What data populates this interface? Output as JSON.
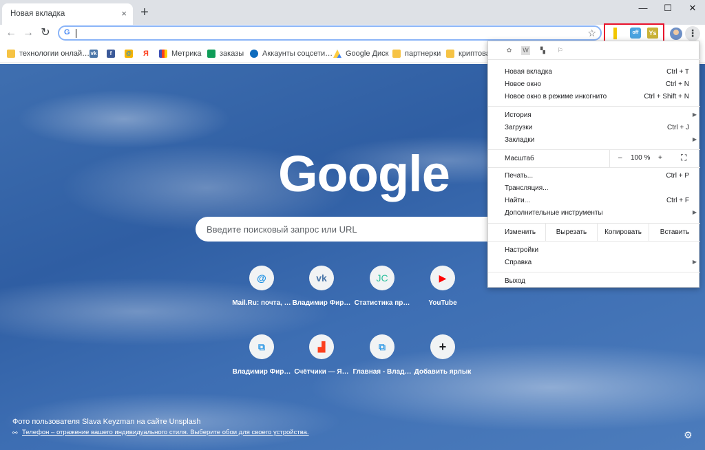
{
  "tab": {
    "title": "Новая вкладка",
    "close": "×",
    "new_tab": "+"
  },
  "window_controls": {
    "minimize": "—",
    "maximize": "☐",
    "close": "✕"
  },
  "toolbar": {
    "back": "←",
    "forward": "→",
    "reload": "↻",
    "omnibox_prefix": "G",
    "star": "☆",
    "menu": "⋮"
  },
  "extensions": [
    {
      "name": "bookmark-ext-icon",
      "glyph": "▌",
      "color": "#f2c600"
    },
    {
      "name": "proxy-off-ext-icon",
      "glyph": "off",
      "color": "#4aa3df"
    },
    {
      "name": "ys-ext-icon",
      "glyph": "Ys",
      "color": "#c9b236"
    }
  ],
  "bookmarks": [
    {
      "label": "технологии онлай…",
      "icon": "folder"
    },
    {
      "label": "",
      "icon": "vk",
      "glyph": "vk",
      "color": "#4a76a8"
    },
    {
      "label": "",
      "icon": "facebook",
      "glyph": "f",
      "color": "#3b5998"
    },
    {
      "label": "",
      "icon": "mailru",
      "glyph": "@",
      "color": "#168de2"
    },
    {
      "label": "",
      "icon": "yandex",
      "glyph": "Я",
      "color": "#ffffff"
    },
    {
      "label": "Метрика",
      "icon": "metrika"
    },
    {
      "label": "заказы",
      "icon": "sheets",
      "color": "#0f9d58"
    },
    {
      "label": "Аккаунты соцсети…",
      "icon": "onedrive",
      "color": "#0f6cbd"
    },
    {
      "label": "Google Диск",
      "icon": "drive"
    },
    {
      "label": "партнерки",
      "icon": "folder"
    },
    {
      "label": "криптова…",
      "icon": "folder"
    }
  ],
  "ntp": {
    "logo": "Google",
    "search_placeholder": "Введите поисковый запрос или URL",
    "tiles": [
      {
        "label": "Mail.Ru: почта, …",
        "glyph": "@",
        "color": "#168de2"
      },
      {
        "label": "Владимир Фир…",
        "glyph": "vk",
        "color": "#4a76a8"
      },
      {
        "label": "Статистика пр…",
        "glyph": "JC",
        "color": "#2bbf9c"
      },
      {
        "label": "YouTube",
        "glyph": "▶",
        "color": "#ff0000"
      },
      {
        "label": "Владимир Фир…",
        "glyph": "⧉",
        "color": "#3b9fe6"
      },
      {
        "label": "Счётчики — Я…",
        "glyph": "▟",
        "color": "#fc3f1d"
      },
      {
        "label": "Главная - Влад…",
        "glyph": "⧉",
        "color": "#3b9fe6"
      },
      {
        "label": "Добавить ярлык",
        "glyph": "+",
        "color": "#202124"
      }
    ],
    "credit": "Фото пользователя Slava Keyzman на сайте Unsplash",
    "credit_link": "Телефон – отражение вашего индивидуального стиля. Выберите обои для своего устройства.",
    "link_icon": "⚯",
    "gear": "⚙"
  },
  "menu": {
    "extensions_row": [
      {
        "name": "puzzle-ext-icon",
        "glyph": "✿"
      },
      {
        "name": "w-ext-icon",
        "glyph": "W"
      },
      {
        "name": "flag-ext-icon",
        "glyph": "▚"
      },
      {
        "name": "pennant-ext-icon",
        "glyph": "⚐"
      }
    ],
    "new_tab": {
      "label": "Новая вкладка",
      "shortcut": "Ctrl + T"
    },
    "new_window": {
      "label": "Новое окно",
      "shortcut": "Ctrl + N"
    },
    "incognito": {
      "label": "Новое окно в режиме инкогнито",
      "shortcut": "Ctrl + Shift + N"
    },
    "history": {
      "label": "История"
    },
    "downloads": {
      "label": "Загрузки",
      "shortcut": "Ctrl + J"
    },
    "bookmarks": {
      "label": "Закладки"
    },
    "zoom": {
      "label": "Масштаб",
      "minus": "–",
      "value": "100 %",
      "plus": "+",
      "fullscreen": "⛶"
    },
    "print": {
      "label": "Печать...",
      "shortcut": "Ctrl + P"
    },
    "cast": {
      "label": "Трансляция..."
    },
    "find": {
      "label": "Найти...",
      "shortcut": "Ctrl + F"
    },
    "more_tools": {
      "label": "Дополнительные инструменты"
    },
    "edit": {
      "label": "Изменить",
      "cut": "Вырезать",
      "copy": "Копировать",
      "paste": "Вставить"
    },
    "settings": {
      "label": "Настройки"
    },
    "help": {
      "label": "Справка"
    },
    "exit": {
      "label": "Выход"
    },
    "arrow": "▶"
  }
}
